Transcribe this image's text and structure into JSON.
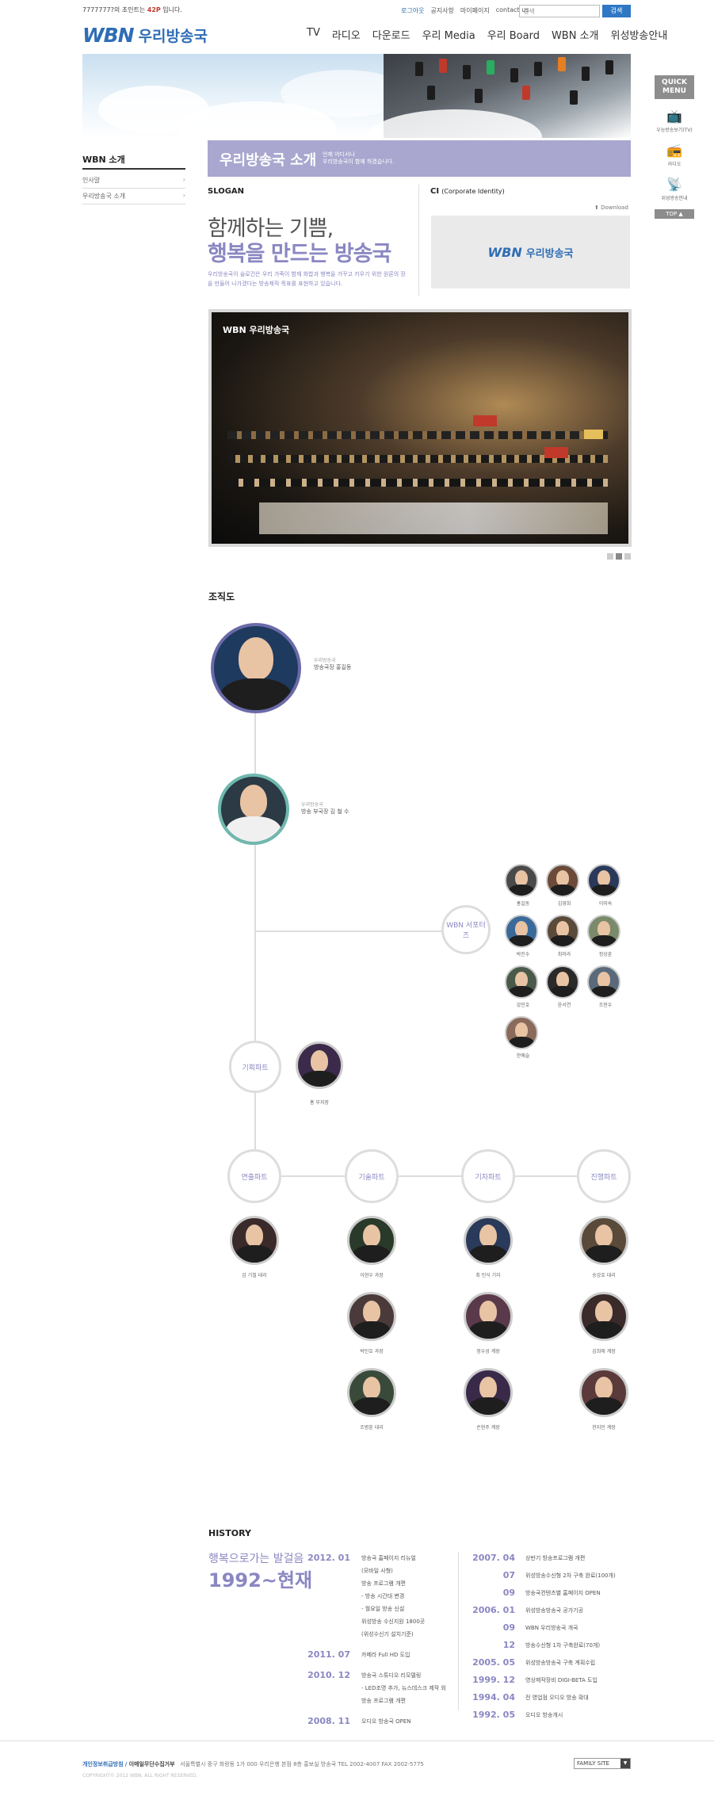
{
  "top": {
    "visitor_prefix": "7777777?",
    "visitor_mid": "의 초인트는 ",
    "visitor_count": "42P",
    "visitor_suffix": " 입니다.",
    "util_links": [
      "로그아웃",
      "공지사항",
      "마이페이지",
      "contact us"
    ],
    "search_placeholder": "검색",
    "search_button": "검색"
  },
  "logo": {
    "mark": "WBN",
    "text": "우리방송국"
  },
  "nav": [
    "TV",
    "라디오",
    "다운로드",
    "우리 Media",
    "우리 Board",
    "WBN 소개",
    "위성방송안내"
  ],
  "quick_menu": {
    "title": "QUICK MENU",
    "items": [
      {
        "label": "우능방송보기(TV)",
        "icon": "tv-icon",
        "glyph": "📺"
      },
      {
        "label": "라디오",
        "icon": "radio-icon",
        "glyph": "📻"
      },
      {
        "label": "위성방송안내",
        "icon": "satellite-icon",
        "glyph": "📡"
      }
    ],
    "top": "TOP ▲"
  },
  "sidebar": {
    "title": "WBN 소개",
    "items": [
      "인사말",
      "우리방송국 소개"
    ]
  },
  "page": {
    "title": "우리방송국 소개",
    "subtitle1": "언제 어디서나",
    "subtitle2": "우리방송국이 함께 하겠습니다.",
    "slogan_label": "SLOGAN",
    "slogan_line1": "함께하는 기쁨,",
    "slogan_line2": "행복을 만드는 방송국",
    "slogan_desc": "우리방송국이 슬로건은 우리 가족이 함께 화합과 행복을 가꾸고 키우기 위한 원론의 장을 만들어 나가겠다는 방송제작 목표를 표현하고 있습니다.",
    "ci_label": "CI",
    "ci_sub": "(Corporate Identity)",
    "download": "Download",
    "ci_mark": "WBN",
    "ci_text": "우리방송국",
    "photo_watermark": "WBN 우리방송국"
  },
  "org": {
    "title": "조직도",
    "head_role_small": "우리방송국",
    "head_role": "방송국장",
    "head_name": "홍길동",
    "deputy_role_small": "우리방송국",
    "deputy_role": "방송 부국장",
    "deputy_name": "김 철 수",
    "supporters": "WBN 서포터즈",
    "planning": "기획파트",
    "planning_member": "홍 부지장",
    "parts": [
      "연출파트",
      "기술파트",
      "기자파트",
      "진행파트"
    ],
    "part_members": [
      [
        "김 기철 대리"
      ],
      [
        "이현우 과장",
        "박민호 과장",
        "조병훈 대리"
      ],
      [
        "최 민식 기자",
        "정우성 계장",
        "손현주 계장"
      ],
      [
        "송강호 대리",
        "김희애 계장",
        "한지민 계장"
      ]
    ],
    "supporter_caps": [
      "홍길동",
      "김영희",
      "이미숙",
      "박진수",
      "최미라",
      "정상훈",
      "강민호",
      "윤서연",
      "조현우",
      "한예슬"
    ]
  },
  "history": {
    "title": "HISTORY",
    "sub": "행복으로가는 발걸음",
    "big": "1992~현재",
    "left": [
      {
        "year": "2012. 01",
        "events": [
          "방송국 홈페이지 리뉴얼",
          "(모바일 사형)",
          "방송 프로그램 개편",
          "- 방송 시간대 변경",
          "- 월요일 방송 신설",
          "위성방송 수신지원 1800곳",
          "(위성수신기 설치기준)"
        ]
      },
      {
        "year": "2011. 07",
        "events": [
          "카메라 Full HD 도입"
        ]
      },
      {
        "year": "2010. 12",
        "events": [
          "방송국 스튜디오 리모델링",
          "- LED조명 추가, 뉴스데스크 제작 외",
          "방송 프로그램 개편"
        ]
      },
      {
        "year": "2008. 11",
        "events": [
          "오디오 방송국 OPEN"
        ]
      }
    ],
    "right": [
      {
        "year": "2007. 04",
        "events": [
          "상반기 방송프로그램 개편"
        ]
      },
      {
        "year": "07",
        "events": [
          "위성방송수신형 2차 구축 완료(100개)"
        ]
      },
      {
        "year": "09",
        "events": [
          "방송국컨텐츠별 홈페이지 OPEN"
        ]
      },
      {
        "year": "2006. 01",
        "events": [
          "위성방송방송국 공가기공"
        ]
      },
      {
        "year": "09",
        "events": [
          "WBN 우리방송국 개국"
        ]
      },
      {
        "year": "12",
        "events": [
          "방송수신형 1차 구축완료(70개)"
        ]
      },
      {
        "year": "2005. 05",
        "events": [
          "위성방송방송국 구축 계획수립"
        ]
      },
      {
        "year": "1999. 12",
        "events": [
          "영상제작장비 DIGI-BETA 도입"
        ]
      },
      {
        "year": "1994. 04",
        "events": [
          "전 영업점 오디오 방송 확대"
        ]
      },
      {
        "year": "1992. 05",
        "events": [
          "오디오 방송개시"
        ]
      }
    ]
  },
  "footer": {
    "privacy": "개인정보취급방침",
    "sep": "/",
    "email": "이메일무단수집거부",
    "address": "서울특별시 중구 화랑동 1가 000 우리은행 본점 8층 홍보실 방송국   TEL 2002-4007  FAX 2002-5775",
    "copyright": "COPYRIGHT© 2012 WBN. ALL RIGHT RESERVED.",
    "family": "FAMILY SITE"
  },
  "colors": {
    "accent": "#8a87c2",
    "brand": "#2f6db5",
    "header_bar": "#a9a7cf"
  }
}
